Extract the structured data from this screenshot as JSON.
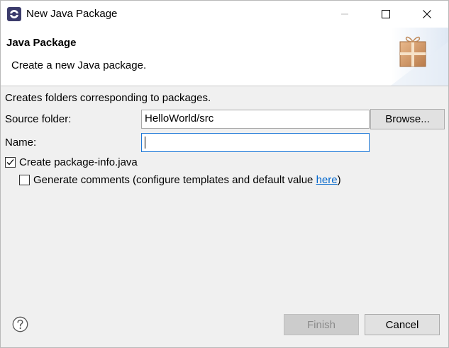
{
  "window": {
    "title": "New Java Package",
    "icon": "eclipse-icon"
  },
  "header": {
    "title": "Java Package",
    "description": "Create a new Java package.",
    "banner_icon": "package-icon"
  },
  "form": {
    "info": "Creates folders corresponding to packages.",
    "source_folder_label": "Source folder:",
    "source_folder_value": "HelloWorld/src",
    "browse_label": "Browse...",
    "name_label": "Name:",
    "name_value": "",
    "create_package_info_label": "Create package-info.java",
    "create_package_info_checked": true,
    "generate_comments_label": "Generate comments (configure templates and default value ",
    "generate_comments_link": "here",
    "generate_comments_suffix": ")",
    "generate_comments_checked": false
  },
  "footer": {
    "finish_label": "Finish",
    "cancel_label": "Cancel",
    "help_icon": "help-icon"
  },
  "colors": {
    "link": "#0066cc",
    "focus_border": "#1e78d7",
    "dialog_bg": "#f0f0f0"
  }
}
